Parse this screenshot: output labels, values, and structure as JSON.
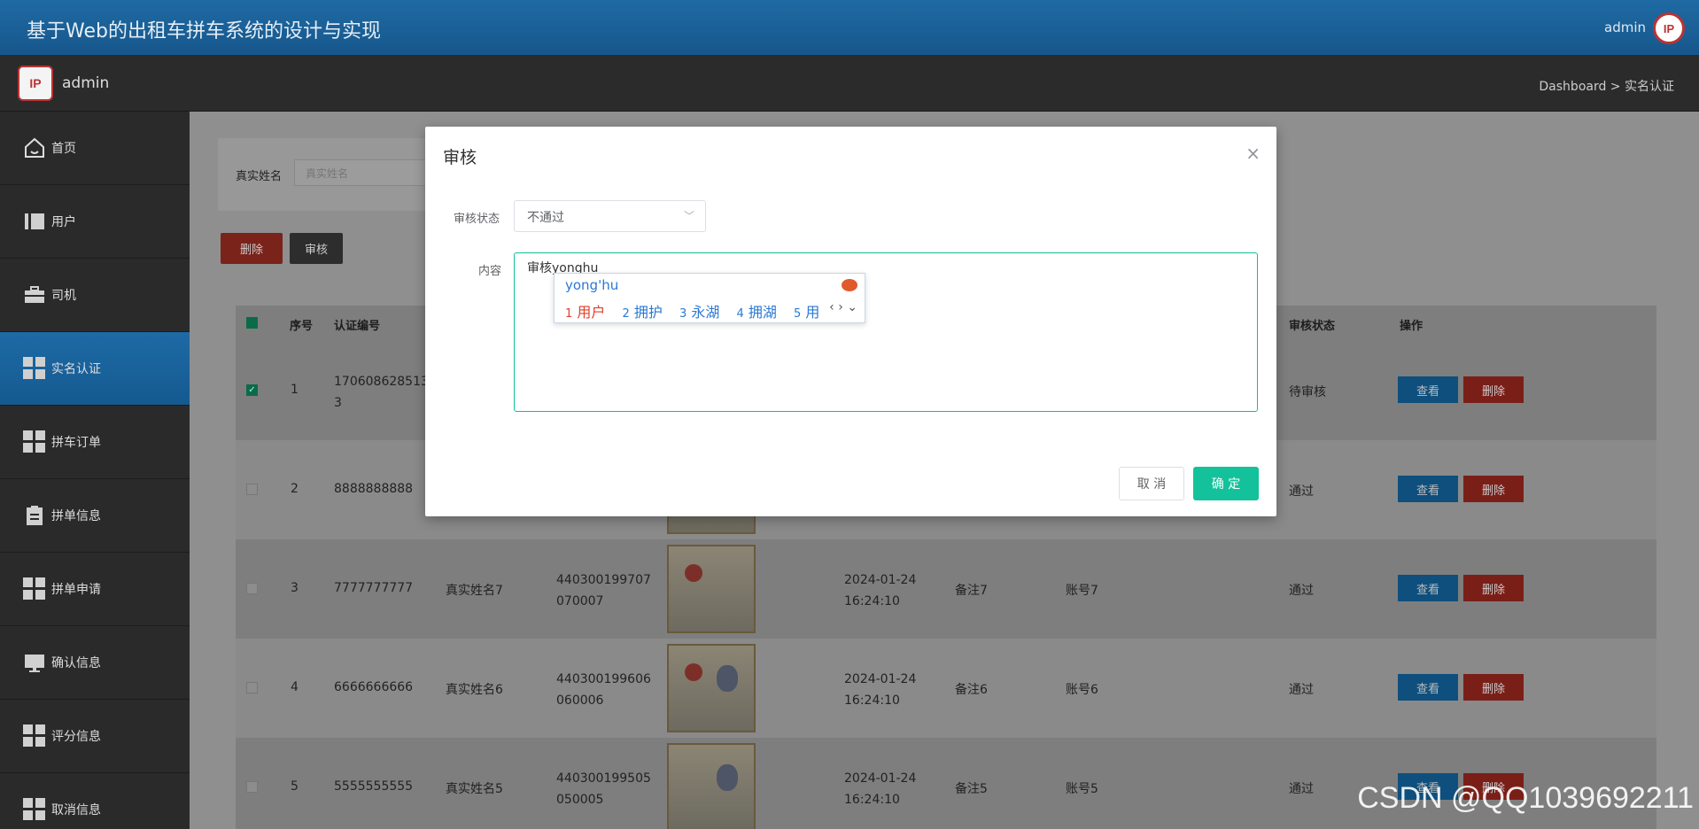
{
  "app": {
    "title": "基于Web的出租车拼车系统的设计与实现",
    "user": "admin",
    "avatar_text": "IP"
  },
  "subbar": {
    "name": "admin",
    "breadcrumb": "Dashboard > 实名认证"
  },
  "sidebar": {
    "items": [
      {
        "label": "首页",
        "icon": "home-icon"
      },
      {
        "label": "用户",
        "icon": "user-icon"
      },
      {
        "label": "司机",
        "icon": "briefcase-icon"
      },
      {
        "label": "实名认证",
        "icon": "grid-icon",
        "active": true
      },
      {
        "label": "拼车订单",
        "icon": "grid-icon"
      },
      {
        "label": "拼单信息",
        "icon": "clipboard-icon"
      },
      {
        "label": "拼单申请",
        "icon": "grid-icon"
      },
      {
        "label": "确认信息",
        "icon": "monitor-icon"
      },
      {
        "label": "评分信息",
        "icon": "grid-icon"
      },
      {
        "label": "取消信息",
        "icon": "grid-icon"
      }
    ]
  },
  "filter": {
    "label": "真实姓名",
    "placeholder": "真实姓名"
  },
  "toolbar": {
    "delete_label": "删除",
    "audit_label": "审核"
  },
  "table": {
    "headers": {
      "index": "序号",
      "cert_no": "认证编号",
      "audit_status": "审核状态",
      "actions": "操作"
    },
    "rows": [
      {
        "index": "1",
        "cert_no": "1706086285133",
        "name": "",
        "id_no": "",
        "time": "",
        "remark": "",
        "account": "",
        "status": "待审核",
        "checked": true
      },
      {
        "index": "2",
        "cert_no": "8888888888",
        "name": "",
        "id_no": "",
        "time": "",
        "remark": "",
        "account": "",
        "status": "通过",
        "checked": false
      },
      {
        "index": "3",
        "cert_no": "7777777777",
        "name": "真实姓名7",
        "id_no": "440300199707070007",
        "time": "2024-01-24 16:24:10",
        "remark": "备注7",
        "account": "账号7",
        "status": "通过",
        "checked": false
      },
      {
        "index": "4",
        "cert_no": "6666666666",
        "name": "真实姓名6",
        "id_no": "440300199606060006",
        "time": "2024-01-24 16:24:10",
        "remark": "备注6",
        "account": "账号6",
        "status": "通过",
        "checked": false
      },
      {
        "index": "5",
        "cert_no": "5555555555",
        "name": "真实姓名5",
        "id_no": "440300199505050005",
        "time": "2024-01-24 16:24:10",
        "remark": "备注5",
        "account": "账号5",
        "status": "通过",
        "checked": false
      }
    ],
    "view_label": "查看",
    "delete_label": "删除"
  },
  "modal": {
    "title": "审核",
    "status_label": "审核状态",
    "status_value": "不通过",
    "content_label": "内容",
    "content_value": "审核yonghu",
    "cancel_label": "取 消",
    "ok_label": "确 定"
  },
  "ime": {
    "pinyin": "yong'hu",
    "candidates": [
      {
        "num": "1",
        "text": "用户"
      },
      {
        "num": "2",
        "text": "拥护"
      },
      {
        "num": "3",
        "text": "永湖"
      },
      {
        "num": "4",
        "text": "拥湖"
      },
      {
        "num": "5",
        "text": "用"
      }
    ]
  },
  "watermark": "CSDN @QQ1039692211"
}
